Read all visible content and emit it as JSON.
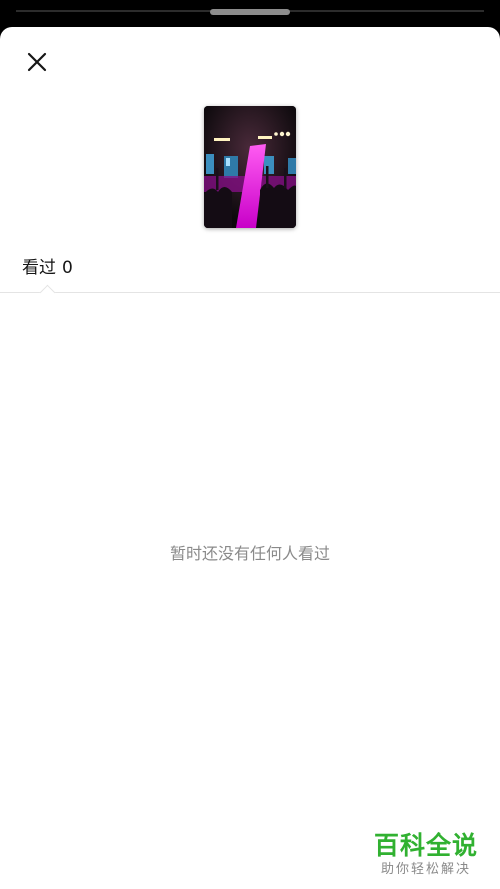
{
  "sheet": {
    "close_icon": "close-icon"
  },
  "tabs": {
    "views_label": "看过",
    "views_count": "0"
  },
  "empty_state": {
    "message": "暂时还没有任何人看过"
  },
  "watermark": {
    "title": "百科全说",
    "subtitle": "助你轻松解决"
  },
  "colors": {
    "background": "#000000",
    "sheet": "#ffffff",
    "text_primary": "#161616",
    "text_secondary": "#8a8a8a",
    "watermark_green": "#31b131",
    "divider": "#e4e4e4"
  }
}
